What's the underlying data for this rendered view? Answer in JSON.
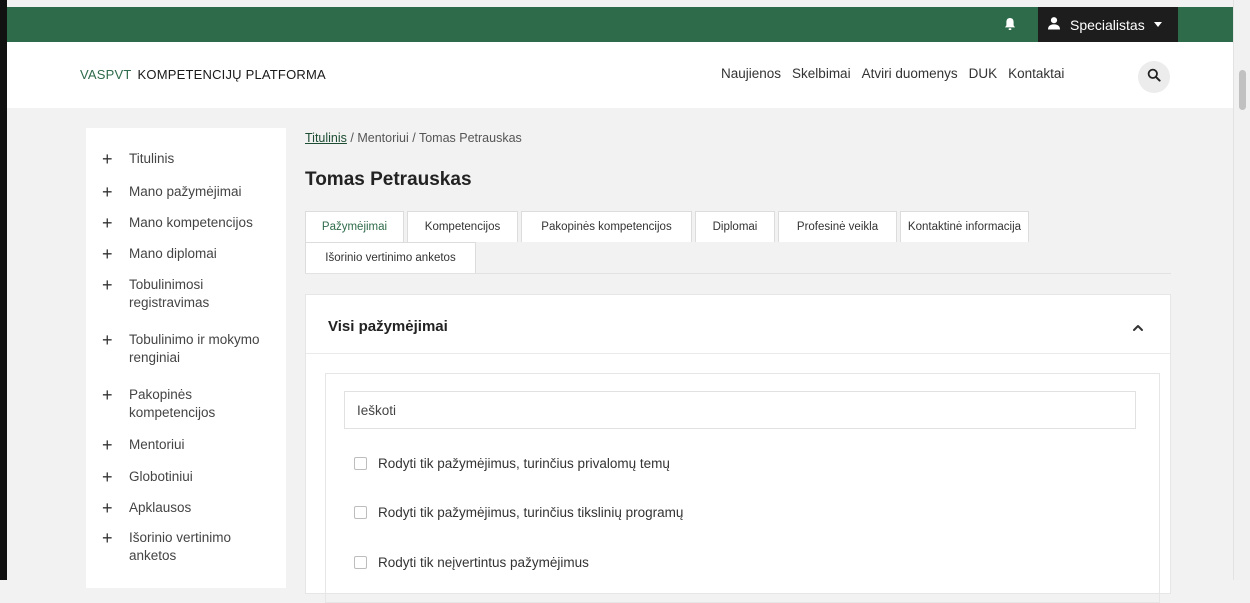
{
  "topbar": {
    "user_menu_label": "Specialistas",
    "brand_color": "#2e6b4a"
  },
  "header": {
    "brand_abbr": "VASPVT",
    "brand_name": "KOMPETENCIJŲ PLATFORMA",
    "nav": [
      "Naujienos",
      "Skelbimai",
      "Atviri duomenys",
      "DUK",
      "Kontaktai"
    ]
  },
  "sidebar": {
    "items": [
      {
        "label": "Titulinis"
      },
      {
        "label": "Mano pažymėjimai"
      },
      {
        "label": "Mano kompetencijos"
      },
      {
        "label": "Mano diplomai"
      },
      {
        "label": "Tobulinimosi registravimas"
      },
      {
        "label": "Tobulinimo ir mokymo renginiai"
      },
      {
        "label": "Pakopinės kompetencijos"
      },
      {
        "label": "Mentoriui"
      },
      {
        "label": "Globotiniui"
      },
      {
        "label": "Apklausos"
      },
      {
        "label": "Išorinio vertinimo anketos"
      }
    ]
  },
  "breadcrumb": {
    "home": "Titulinis",
    "separator": " / ",
    "section": "Mentoriui",
    "current": "Tomas Petrauskas"
  },
  "page": {
    "title": "Tomas Petrauskas"
  },
  "tabs": [
    {
      "label": "Pažymėjimai",
      "active": true
    },
    {
      "label": "Kompetencijos"
    },
    {
      "label": "Pakopinės kompetencijos"
    },
    {
      "label": "Diplomai"
    },
    {
      "label": "Profesinė veikla"
    },
    {
      "label": "Kontaktinė informacija"
    },
    {
      "label": "Išorinio vertinimo anketos"
    }
  ],
  "certificates": {
    "title": "Visi pažymėjimai",
    "search_placeholder": "Ieškoti",
    "filters": [
      {
        "label": "Rodyti tik pažymėjimus, turinčius privalomų temų",
        "checked": false
      },
      {
        "label": "Rodyti tik pažymėjimus, turinčius tikslinių programų",
        "checked": false
      },
      {
        "label": "Rodyti tik neįvertintus pažymėjimus",
        "checked": false
      }
    ]
  }
}
